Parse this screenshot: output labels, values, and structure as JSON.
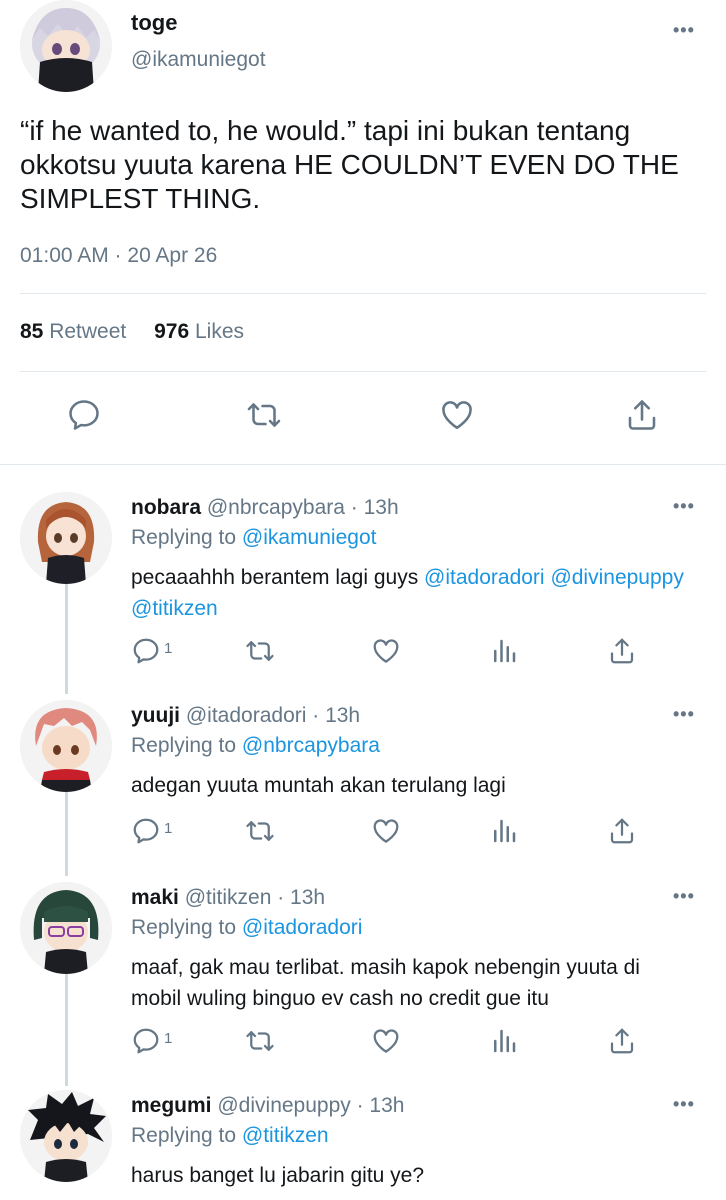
{
  "main_tweet": {
    "name": "toge",
    "handle": "@ikamuniegot",
    "more_label": "•••",
    "text": "“if he wanted to, he would.” tapi ini bukan tentang okkotsu yuuta karena HE COULDN’T EVEN DO THE SIMPLEST THING.",
    "timestamp": "01:00 AM · 20 Apr 26",
    "retweets_count": "85",
    "retweets_label": "Retweet",
    "likes_count": "976",
    "likes_label": "Likes",
    "actions": [
      "reply-icon",
      "retweet-icon",
      "like-icon",
      "share-icon"
    ]
  },
  "replies": [
    {
      "name": "nobara",
      "handle": "@nbrcapybara · 13h",
      "replying_prefix": "Replying to",
      "replying_to": "@ikamuniegot",
      "text_plain": "pecaaahhh berantem lagi guys",
      "mentions": [
        "@itadoradori",
        "@divinepuppy",
        "@titikzen"
      ],
      "reply_count": "1",
      "more_label": "•••"
    },
    {
      "name": "yuuji",
      "handle": "@itadoradori · 13h",
      "replying_prefix": "Replying to",
      "replying_to": "@nbrcapybara",
      "text": "adegan yuuta muntah akan terulang lagi",
      "reply_count": "1",
      "more_label": "•••"
    },
    {
      "name": "maki",
      "handle": "@titikzen · 13h",
      "replying_prefix": "Replying to",
      "replying_to": "@itadoradori",
      "text": "maaf, gak mau terlibat. masih kapok nebengin yuuta di mobil wuling binguo ev cash no credit gue itu",
      "reply_count": "1",
      "more_label": "•••"
    },
    {
      "name": "megumi",
      "handle": "@divinepuppy · 13h",
      "replying_prefix": "Replying to",
      "replying_to": "@titikzen",
      "text": "harus banget lu jabarin gitu ye?",
      "more_label": "•••"
    }
  ],
  "colors": {
    "link": "#1b95e0",
    "secondary_text": "#657786",
    "primary_text": "#14171a",
    "divider": "#e1e8ed"
  }
}
